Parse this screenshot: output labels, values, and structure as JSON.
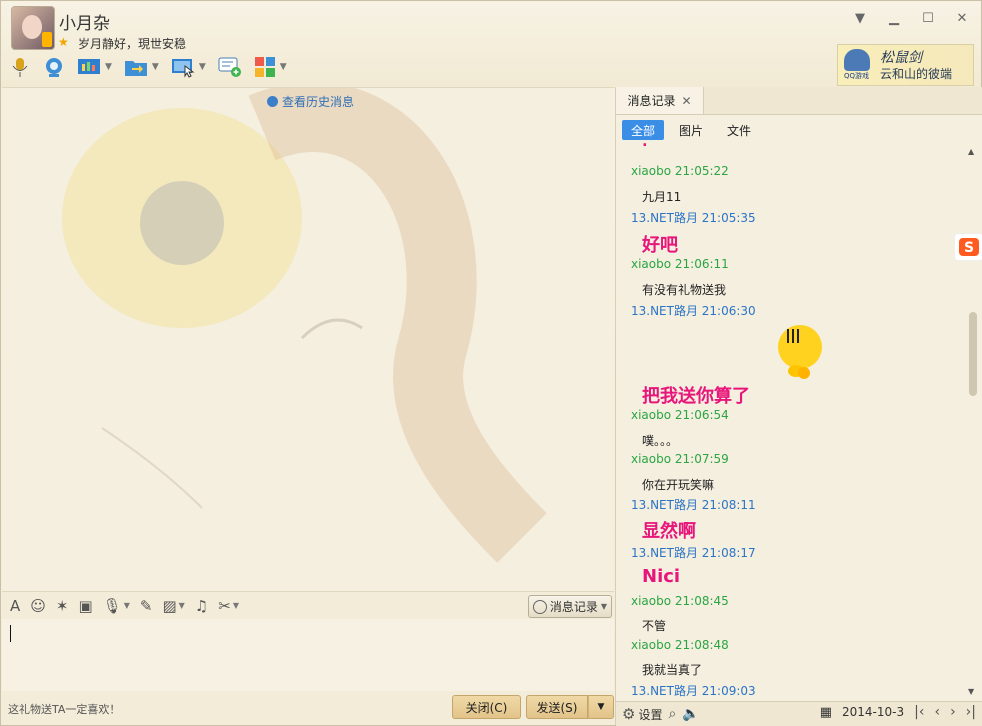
{
  "contact": {
    "name": "小月杂",
    "signature": "岁月静好，現世安稳"
  },
  "ad_banner": {
    "line1": "松鼠剑",
    "line2": "云和山的彼端",
    "brand": "QQ游戏"
  },
  "chat": {
    "history_link": "查看历史消息",
    "ad_text": "这礼物送TA一定喜欢！",
    "msglog_button": "消息记录",
    "close_button": "关闭(C)",
    "send_button": "发送(S)"
  },
  "side": {
    "tab_label": "消息记录",
    "filters": [
      "全部",
      "图片",
      "文件"
    ],
    "messages": [
      {
        "type": "hdr-x",
        "text": "xiaobo 21:05:22"
      },
      {
        "type": "txt",
        "text": "九月11"
      },
      {
        "type": "hdr-n",
        "text": "13.NET路月 21:05:35"
      },
      {
        "type": "big",
        "text": "好吧"
      },
      {
        "type": "hdr-x",
        "text": "xiaobo 21:06:11"
      },
      {
        "type": "txt",
        "text": "有没有礼物送我"
      },
      {
        "type": "hdr-n",
        "text": "13.NET路月 21:06:30"
      },
      {
        "type": "big",
        "text": "把我送你算了"
      },
      {
        "type": "hdr-x",
        "text": "xiaobo 21:06:54"
      },
      {
        "type": "txt",
        "text": "噗。。。"
      },
      {
        "type": "hdr-x",
        "text": "xiaobo 21:07:59"
      },
      {
        "type": "txt",
        "text": "你在开玩笑嘛"
      },
      {
        "type": "hdr-n",
        "text": "13.NET路月 21:08:11"
      },
      {
        "type": "big",
        "text": "显然啊"
      },
      {
        "type": "hdr-n",
        "text": "13.NET路月 21:08:17"
      },
      {
        "type": "big",
        "text": "Nici"
      },
      {
        "type": "hdr-x",
        "text": "xiaobo 21:08:45"
      },
      {
        "type": "txt",
        "text": "不管"
      },
      {
        "type": "hdr-x",
        "text": "xiaobo 21:08:48"
      },
      {
        "type": "txt",
        "text": "我就当真了"
      },
      {
        "type": "hdr-n",
        "text": "13.NET路月 21:09:03"
      }
    ],
    "settings": "设置",
    "date": "2014-10-3"
  },
  "colors": {
    "pink_text": "#e8157a",
    "green_name": "#2aa542",
    "blue_name": "#2a74c6",
    "accent": "#3a8ee6"
  }
}
